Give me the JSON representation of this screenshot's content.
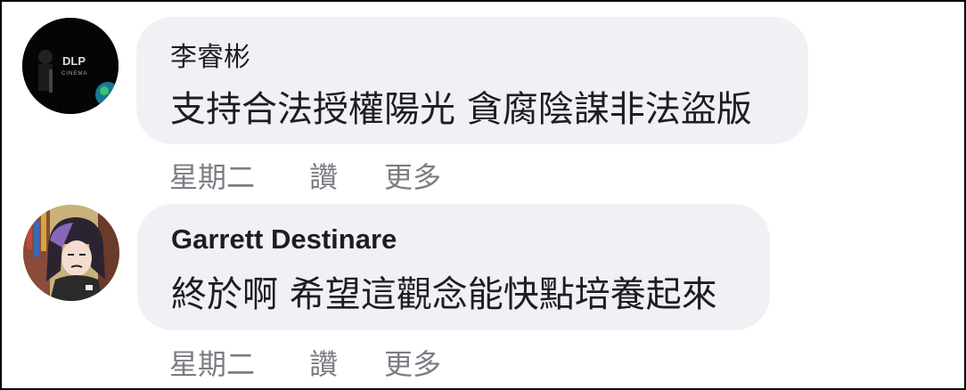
{
  "comments": [
    {
      "author": "李睿彬",
      "text": "支持合法授權陽光 貪腐陰謀非法盜版",
      "timestamp": "星期二",
      "like_label": "讚",
      "more_label": "更多",
      "avatar_text": "DLP",
      "avatar_subtext": "CINEMA"
    },
    {
      "author": "Garrett Destinare",
      "text": "終於啊 希望這觀念能快點培養起來",
      "timestamp": "星期二",
      "like_label": "讚",
      "more_label": "更多"
    }
  ]
}
